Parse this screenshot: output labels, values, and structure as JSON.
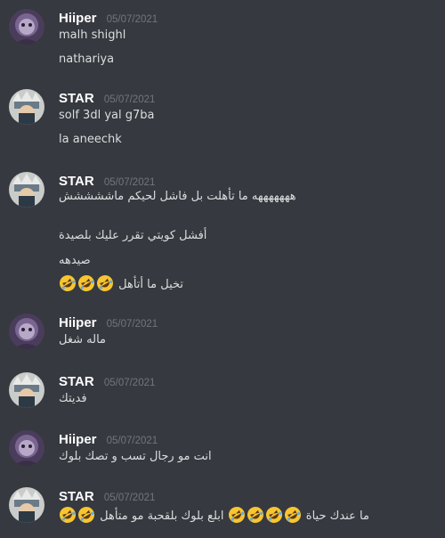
{
  "messages": [
    {
      "author": "Hiiper",
      "avatar_icon": "hiiper-avatar-icon",
      "timestamp": "05/07/2021",
      "lines": [
        "malh shighl",
        "nathariya"
      ]
    },
    {
      "author": "STAR",
      "avatar_icon": "star-avatar-icon",
      "timestamp": "05/07/2021",
      "lines": [
        "solf 3dl yal g7ba",
        "la aneechk"
      ]
    },
    {
      "author": "STAR",
      "avatar_icon": "star-avatar-icon",
      "timestamp": "05/07/2021",
      "lines": [
        "هههههههه ما تأهلت بل فاشل لحيكم ماششششش",
        "أفشل كويتي   تقرر عليك بلصيدة",
        "صيدهه",
        "تخيل ما أتأهل"
      ],
      "emoji": "rolling-on-floor-laughing-emoji"
    },
    {
      "author": "Hiiper",
      "avatar_icon": "hiiper-avatar-icon",
      "timestamp": "05/07/2021",
      "lines": [
        "ماله شغل"
      ]
    },
    {
      "author": "STAR",
      "avatar_icon": "star-avatar-icon",
      "timestamp": "05/07/2021",
      "lines": [
        "فديتك"
      ]
    },
    {
      "author": "Hiiper",
      "avatar_icon": "hiiper-avatar-icon",
      "timestamp": "05/07/2021",
      "lines": [
        "انت مو رجال تسب و تصك بلوك"
      ]
    },
    {
      "author": "STAR",
      "avatar_icon": "star-avatar-icon",
      "timestamp": "05/07/2021",
      "lines": [
        "ابلع بلوك بلقحبة  مو متأهل",
        "ما عندك حياة"
      ],
      "emoji": "rolling-on-floor-laughing-emoji"
    }
  ],
  "colors": {
    "background": "#36393f",
    "author": "#ffffff",
    "timestamp": "#72767d",
    "message_text": "#dcddde",
    "emoji_face": "#f7c531"
  }
}
